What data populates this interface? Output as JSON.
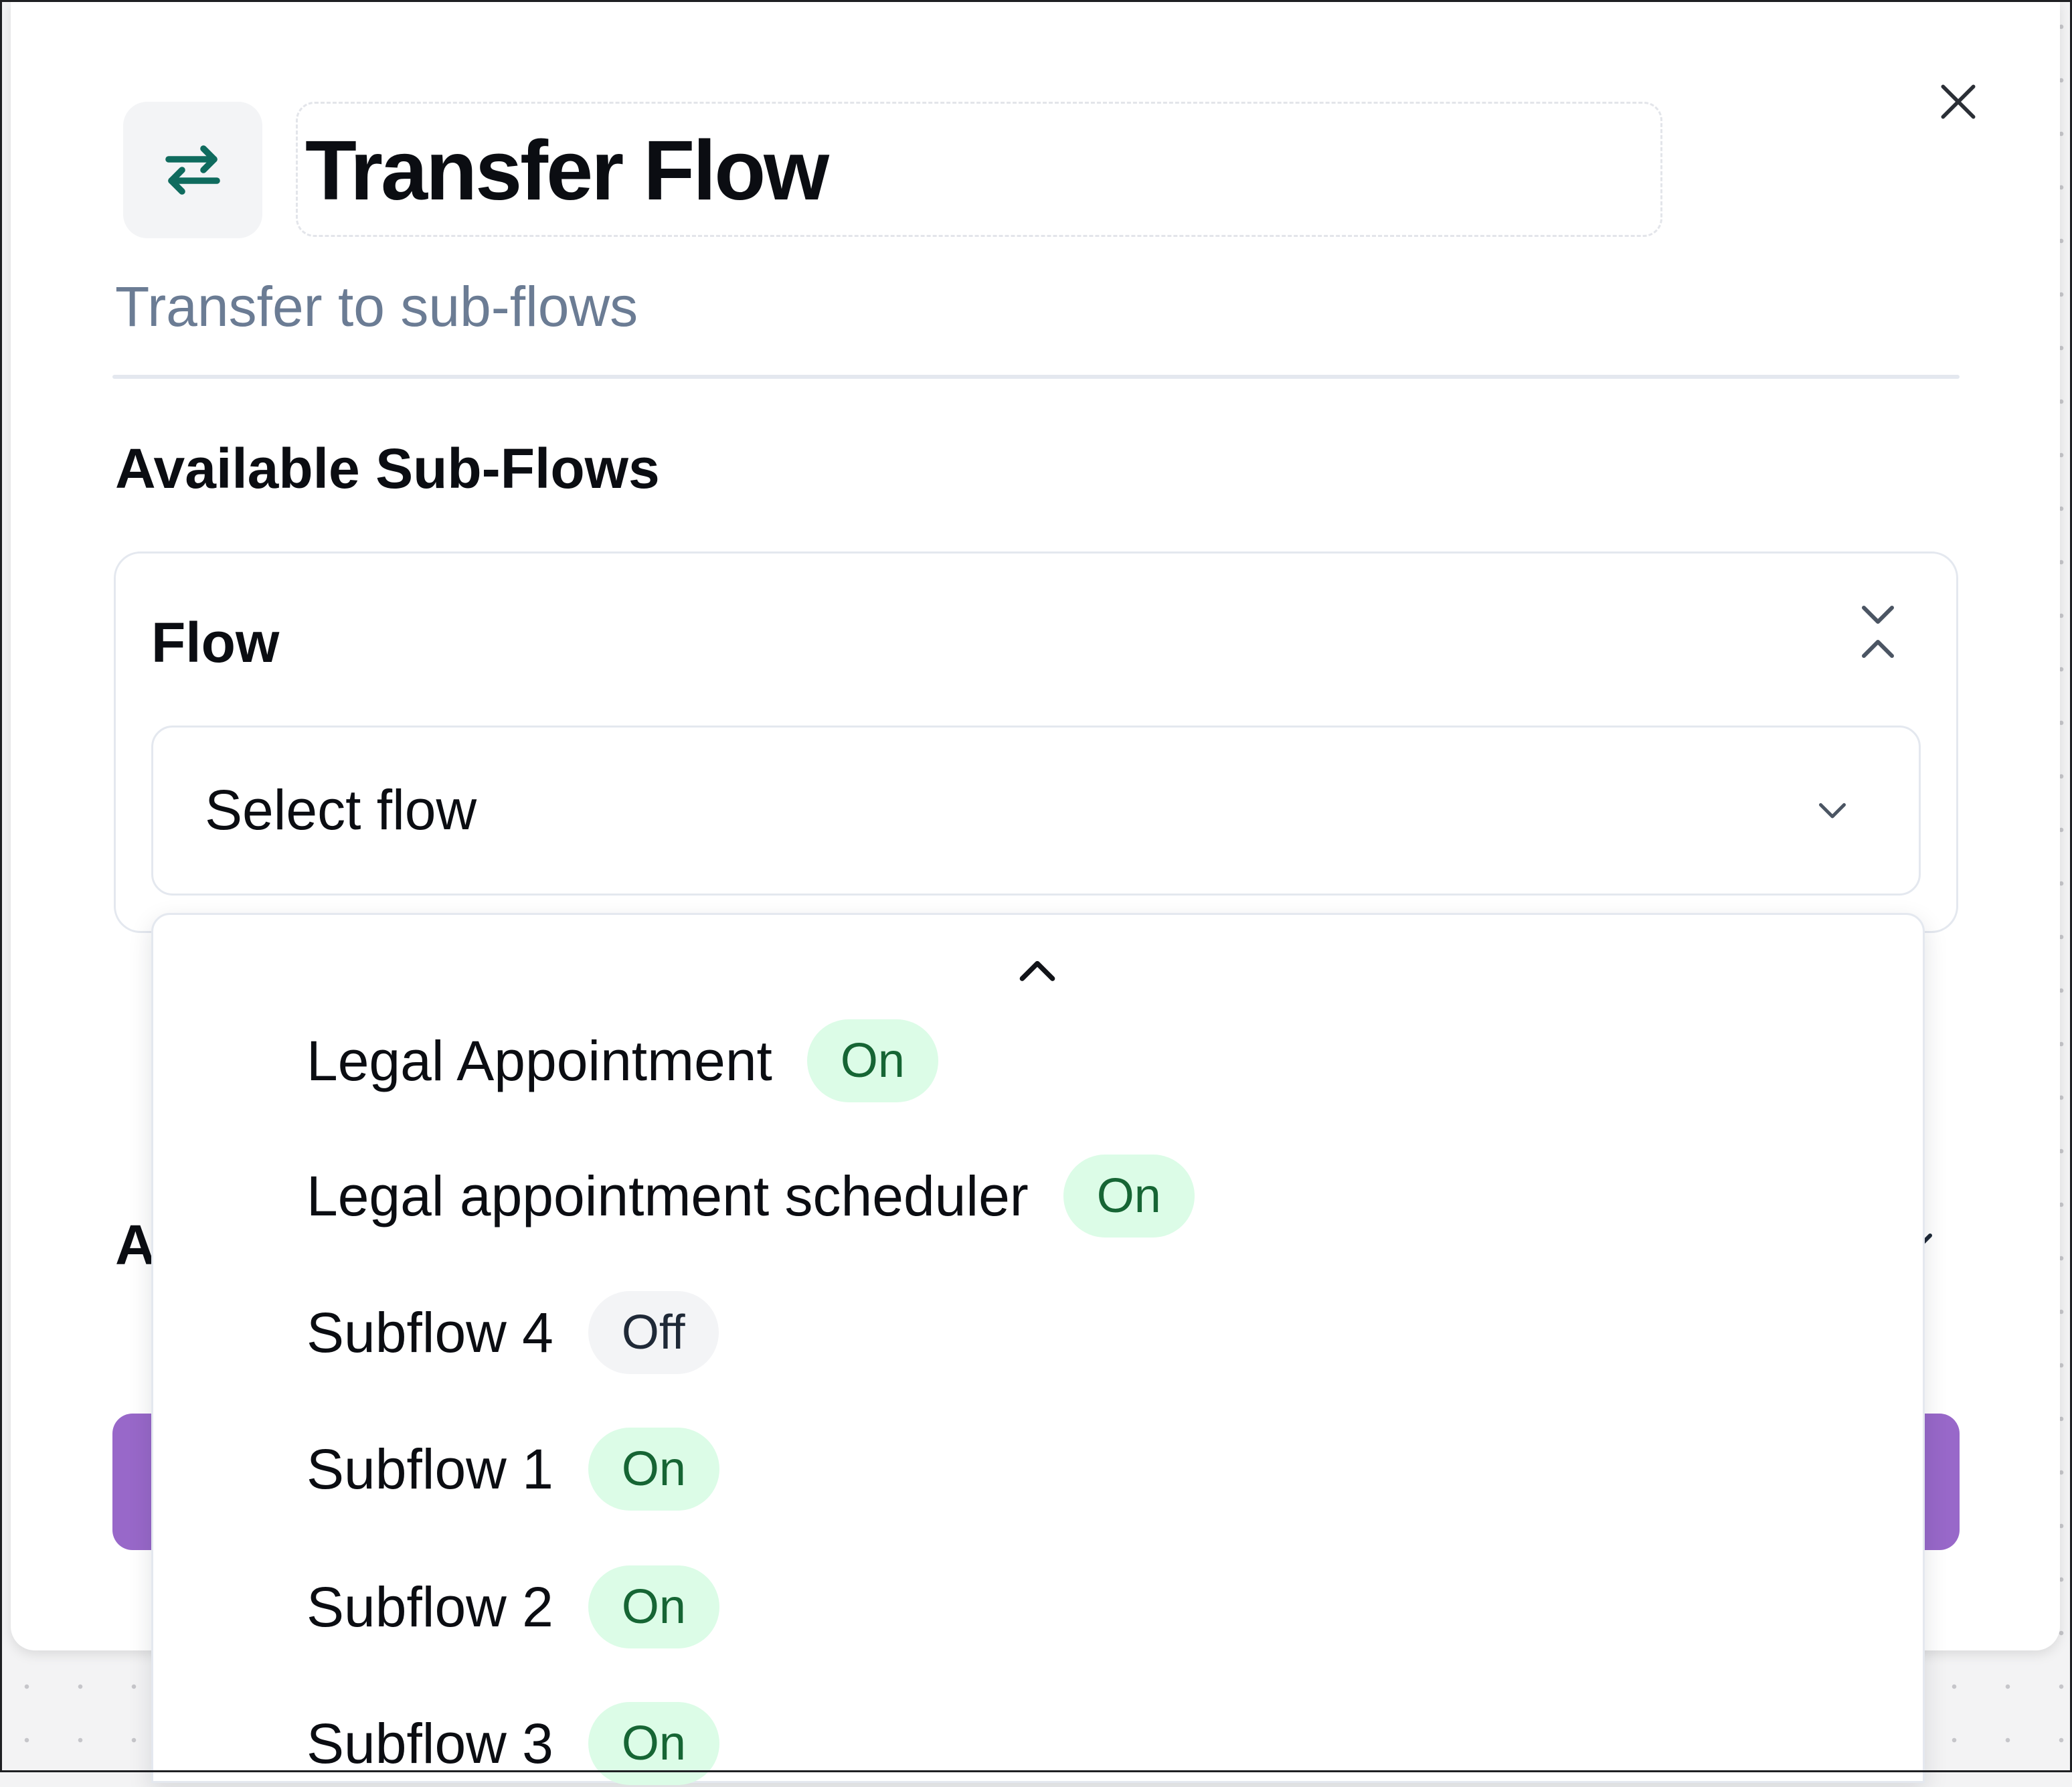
{
  "header": {
    "title": "Transfer Flow",
    "subtitle": "Transfer to sub-flows",
    "icon": "transfer-arrows-icon"
  },
  "section": {
    "heading": "Available Sub-Flows",
    "peek_heading_initial": "A"
  },
  "flow_card": {
    "label": "Flow",
    "select_placeholder": "Select flow"
  },
  "dropdown": {
    "options": [
      {
        "label": "Legal Appointment",
        "status": "On"
      },
      {
        "label": "Legal appointment scheduler",
        "status": "On"
      },
      {
        "label": "Subflow 4",
        "status": "Off"
      },
      {
        "label": "Subflow 1",
        "status": "On"
      },
      {
        "label": "Subflow 2",
        "status": "On"
      },
      {
        "label": "Subflow 3",
        "status": "On"
      }
    ]
  },
  "colors": {
    "accent_teal": "#0f6b5e",
    "button_purple": "#9868c9",
    "on_badge_bg": "#dcfce7",
    "on_badge_text": "#166534",
    "off_badge_bg": "#f3f4f6",
    "subtitle_text": "#6b7c94"
  }
}
